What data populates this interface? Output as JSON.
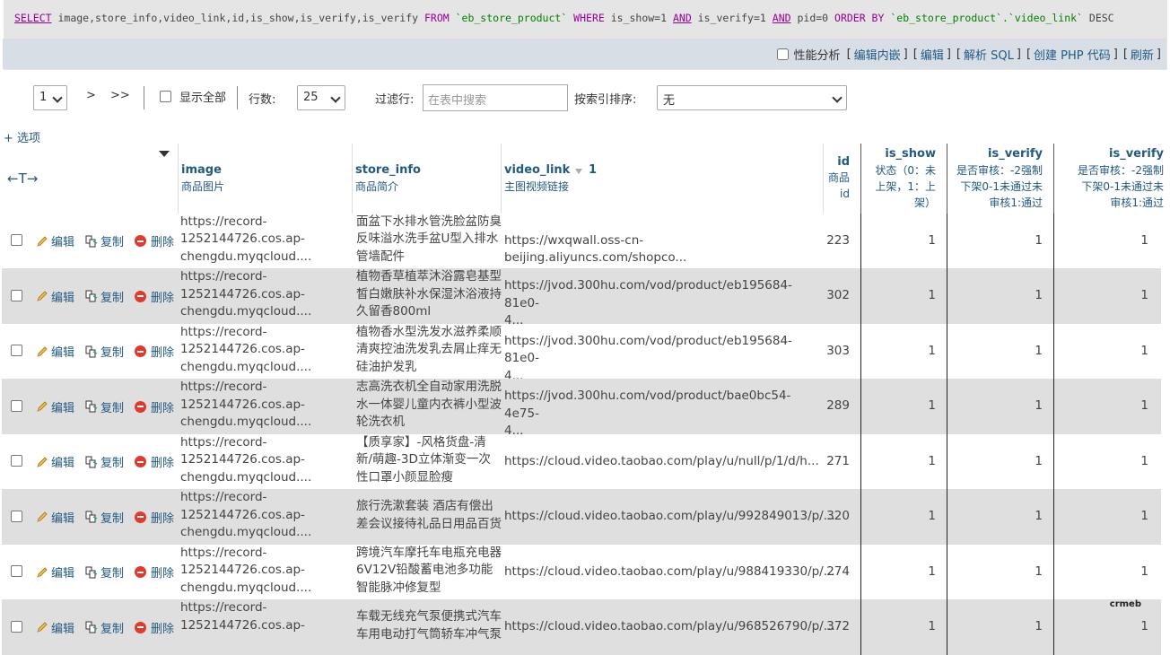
{
  "sql": {
    "select": "SELECT",
    "cols": " image,store_info,video_link,id,is_show,is_verify,is_verify ",
    "from": "FROM",
    "table1": "`eb_store_product`",
    "where": "WHERE",
    "cond1": " is_show=1 ",
    "and1": "AND",
    "cond2": " is_verify=1 ",
    "and2": "AND",
    "cond3": " pid=0 ",
    "order": "ORDER BY",
    "table2": "`eb_store_product`.`video_link`",
    "desc": " DESC"
  },
  "sql_tools": {
    "profiling": "性能分析",
    "edit_inline": "编辑内嵌",
    "edit": "编辑",
    "explain": "解析 SQL",
    "create_php": "创建 PHP 代码",
    "refresh": "刷新"
  },
  "nav": {
    "page": "1",
    "next": ">",
    "last": ">>",
    "show_all": "显示全部",
    "rows_label": "行数:",
    "rows_value": "25",
    "filter_label": "过滤行:",
    "filter_placeholder": "在表中搜索",
    "sort_label": "按索引排序:",
    "sort_value": "无"
  },
  "options": "+ 选项",
  "header": {
    "arrows": "←T→",
    "columns": [
      {
        "name": "image",
        "comment": "商品图片"
      },
      {
        "name": "store_info",
        "comment": "商品简介"
      },
      {
        "name": "video_link",
        "sort_no": "1",
        "comment": "主图视频链接"
      },
      {
        "name": "id",
        "comment1": "商品",
        "comment2": "id"
      },
      {
        "name": "is_show",
        "c1": "状态（0：未",
        "c2": "上架，1：上",
        "c3": "架）"
      },
      {
        "name": "is_verify",
        "c1": "是否审核：-2强制",
        "c2": "下架0-1未通过未",
        "c3": "审核1:通过"
      },
      {
        "name": "is_verify",
        "c1": "是否审核：-2强制",
        "c2": "下架0-1未通过未",
        "c3": "审核1:通过"
      }
    ]
  },
  "actions": {
    "edit": "编辑",
    "copy": "复制",
    "delete": "删除"
  },
  "rows": [
    {
      "img1": "https://record-",
      "img2": "1252144726.cos.ap-",
      "img3": "chengdu.myqcloud....",
      "info1": "面盆下水排水管洗脸盆防臭",
      "info2": "反味溢水洗手盆U型入排水",
      "info3": "管墙配件",
      "video": "https://wxqwall.oss-cn-beijing.aliyuncs.com/shopco...",
      "video2": "",
      "id": "223",
      "is_show": "1",
      "v1": "1",
      "v2": "1"
    },
    {
      "img1": "https://record-",
      "img2": "1252144726.cos.ap-",
      "img3": "chengdu.myqcloud....",
      "info1": "植物香草植萃沐浴露皂基型",
      "info2": "皙白嫩肤补水保湿沐浴液持",
      "info3": "久留香800ml",
      "video": "https://jvod.300hu.com/vod/product/eb195684-81e0-",
      "video2": "4...",
      "id": "302",
      "is_show": "1",
      "v1": "1",
      "v2": "1"
    },
    {
      "img1": "https://record-",
      "img2": "1252144726.cos.ap-",
      "img3": "chengdu.myqcloud....",
      "info1": "植物香水型洗发水滋养柔顺",
      "info2": "清爽控油洗发乳去屑止痒无",
      "info3": "硅油护发乳",
      "video": "https://jvod.300hu.com/vod/product/eb195684-81e0-",
      "video2": "4...",
      "id": "303",
      "is_show": "1",
      "v1": "1",
      "v2": "1"
    },
    {
      "img1": "https://record-",
      "img2": "1252144726.cos.ap-",
      "img3": "chengdu.myqcloud....",
      "info1": "志高洗衣机全自动家用洗脱",
      "info2": "水一体婴儿童内衣裤小型波",
      "info3": "轮洗衣机",
      "video": "https://jvod.300hu.com/vod/product/bae0bc54-4e75-",
      "video2": "4...",
      "id": "289",
      "is_show": "1",
      "v1": "1",
      "v2": "1"
    },
    {
      "img1": "https://record-",
      "img2": "1252144726.cos.ap-",
      "img3": "chengdu.myqcloud....",
      "info1": "【质享家】-风格货盘-清",
      "info2": "新/萌趣-3D立体渐变一次",
      "info3": "性口罩小颜显脸瘦",
      "video": "https://cloud.video.taobao.com/play/u/null/p/1/d/h...",
      "video2": "",
      "id": "271",
      "is_show": "1",
      "v1": "1",
      "v2": "1"
    },
    {
      "img1": "https://record-",
      "img2": "1252144726.cos.ap-",
      "img3": "chengdu.myqcloud....",
      "info1": "旅行洗漱套装 酒店有偿出",
      "info2": "差会议接待礼品日用品百货",
      "info3": "",
      "video": "https://cloud.video.taobao.com/play/u/992849013/p/...",
      "video2": "",
      "id": "320",
      "is_show": "1",
      "v1": "1",
      "v2": "1"
    },
    {
      "img1": "https://record-",
      "img2": "1252144726.cos.ap-",
      "img3": "chengdu.myqcloud....",
      "info1": "跨境汽车摩托车电瓶充电器",
      "info2": "6V12V铅酸蓄电池多功能",
      "info3": "智能脉冲修复型",
      "video": "https://cloud.video.taobao.com/play/u/988419330/p/...",
      "video2": "",
      "id": "274",
      "is_show": "1",
      "v1": "1",
      "v2": "1"
    },
    {
      "img1": "https://record-",
      "img2": "1252144726.cos.ap-",
      "img3": "",
      "info1": "车载无线充气泵便携式汽车",
      "info2": "车用电动打气筒轿车冲气泵",
      "info3": "",
      "video": "https://cloud.video.taobao.com/play/u/968526790/p/...",
      "video2": "",
      "id": "372",
      "is_show": "1",
      "v1": "1",
      "v2": "1"
    }
  ],
  "watermark": "crmeb"
}
